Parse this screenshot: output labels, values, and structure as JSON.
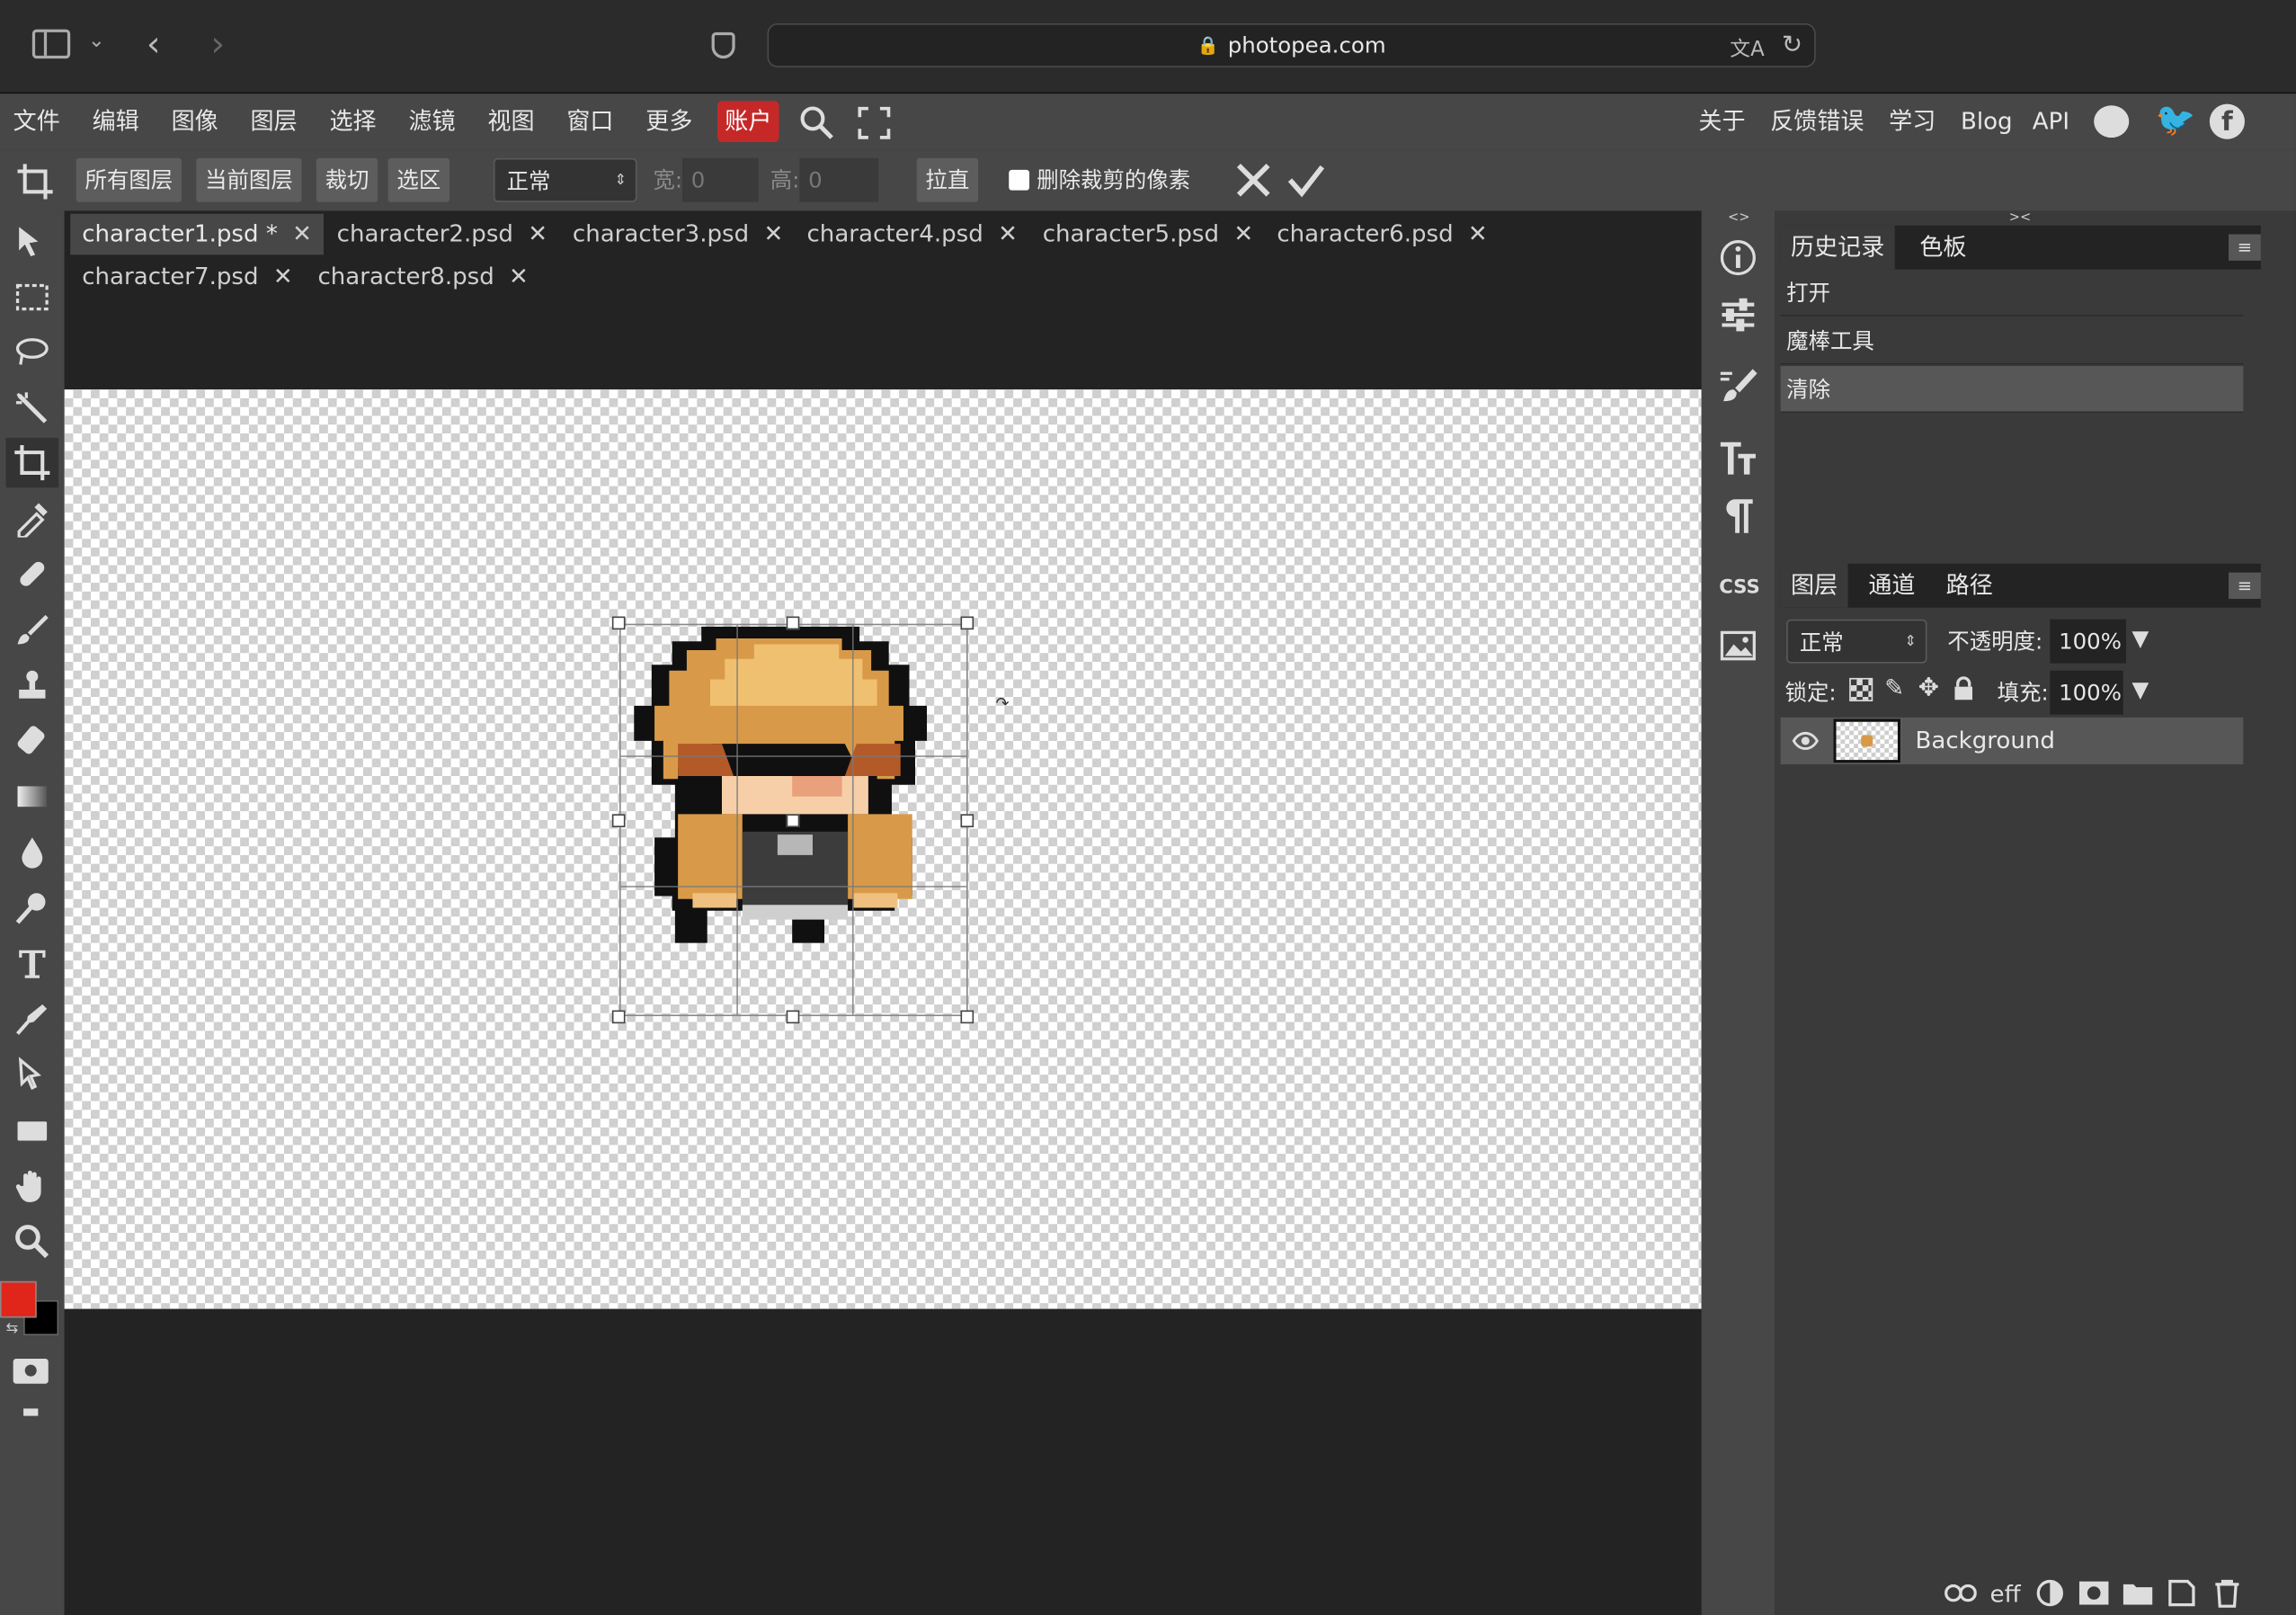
{
  "browser": {
    "url": "photopea.com"
  },
  "menu": {
    "items": [
      "文件",
      "编辑",
      "图像",
      "图层",
      "选择",
      "滤镜",
      "视图",
      "窗口",
      "更多"
    ],
    "account": "账户",
    "right": [
      "关于",
      "反馈错误",
      "学习",
      "Blog",
      "API"
    ]
  },
  "options": {
    "buttons": [
      "所有图层",
      "当前图层",
      "裁切",
      "选区"
    ],
    "mode": "正常",
    "width_label": "宽:",
    "width_value": "0",
    "height_label": "高:",
    "height_value": "0",
    "straighten": "拉直",
    "delete_pixels": "删除裁剪的像素"
  },
  "tabs": [
    {
      "label": "character1.psd *",
      "active": true
    },
    {
      "label": "character2.psd"
    },
    {
      "label": "character3.psd"
    },
    {
      "label": "character4.psd"
    },
    {
      "label": "character5.psd"
    },
    {
      "label": "character6.psd"
    },
    {
      "label": "character7.psd"
    },
    {
      "label": "character8.psd"
    }
  ],
  "history_panel": {
    "tabs": [
      "历史记录",
      "色板"
    ],
    "items": [
      "打开",
      "魔棒工具",
      "清除"
    ]
  },
  "layers_panel": {
    "tabs": [
      "图层",
      "通道",
      "路径"
    ],
    "blend_mode": "正常",
    "opacity_label": "不透明度:",
    "opacity": "100%",
    "lock_label": "锁定:",
    "fill_label": "填充:",
    "fill": "100%",
    "layers": [
      {
        "name": "Background"
      }
    ],
    "footer_fx": "eff"
  },
  "colors": {
    "foreground": "#e0251b",
    "background": "#000000",
    "accent": "#c62828"
  }
}
